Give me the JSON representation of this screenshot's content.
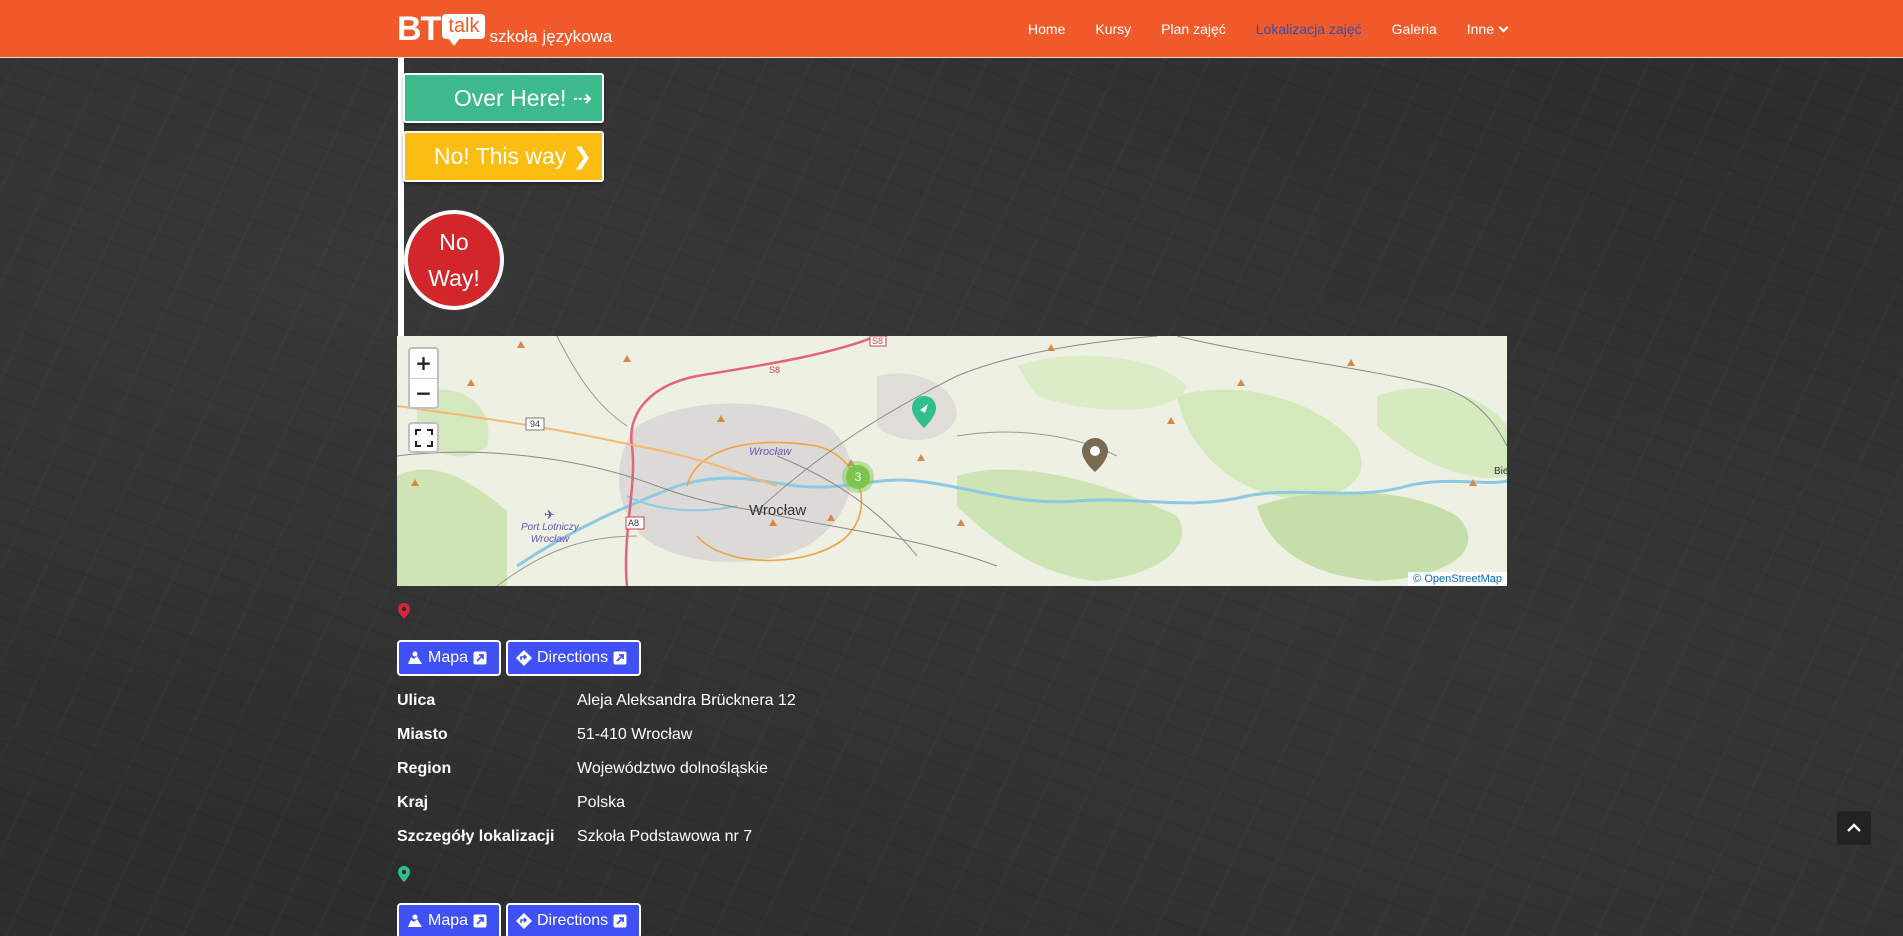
{
  "header": {
    "logo": {
      "bt": "BT",
      "talk": "talk",
      "subtitle": "szkoła językowa"
    },
    "nav": [
      {
        "label": "Home"
      },
      {
        "label": "Kursy"
      },
      {
        "label": "Plan zajęć"
      },
      {
        "label": "Lokalizacja zajęć",
        "active": true
      },
      {
        "label": "Galeria"
      },
      {
        "label": "Inne",
        "has_dropdown": true
      }
    ],
    "colors": {
      "bar": "#f15a2b",
      "active_link": "#2d4fb0"
    }
  },
  "signs": {
    "over_here": "Over Here! ⇢",
    "no_this_way": "No! This way ❯",
    "no_way_line1": "No",
    "no_way_line2": "Way!"
  },
  "map": {
    "zoom_in": "+",
    "zoom_out": "−",
    "fullscreen_icon": "fullscreen-icon",
    "attribution": "© OpenStreetMap",
    "cluster_count": "3",
    "city_main": "Wrocław",
    "city_small": "Wrocław",
    "airport_line1": "Port Lotniczy",
    "airport_line2": "Wrocław",
    "road_labels": [
      "S8",
      "S8",
      "94",
      "A8"
    ],
    "edge_label": "Bie",
    "marker_colors": {
      "green": "#2fbf8a",
      "brown": "#7a6a52"
    }
  },
  "locations": [
    {
      "pin_color": "#d3263d",
      "map_button": "Mapa",
      "directions_button": "Directions",
      "details": [
        {
          "label": "Ulica",
          "value": "Aleja Aleksandra Brücknera 12"
        },
        {
          "label": "Miasto",
          "value": "51-410 Wrocław"
        },
        {
          "label": "Region",
          "value": "Województwo dolnośląskie"
        },
        {
          "label": "Kraj",
          "value": "Polska"
        },
        {
          "label": "Szczegóły lokalizacji",
          "value": "Szkoła Podstawowa nr 7"
        }
      ]
    },
    {
      "pin_color": "#2fbf8a",
      "map_button": "Mapa",
      "directions_button": "Directions"
    }
  ],
  "button_color": "#3f51f5"
}
